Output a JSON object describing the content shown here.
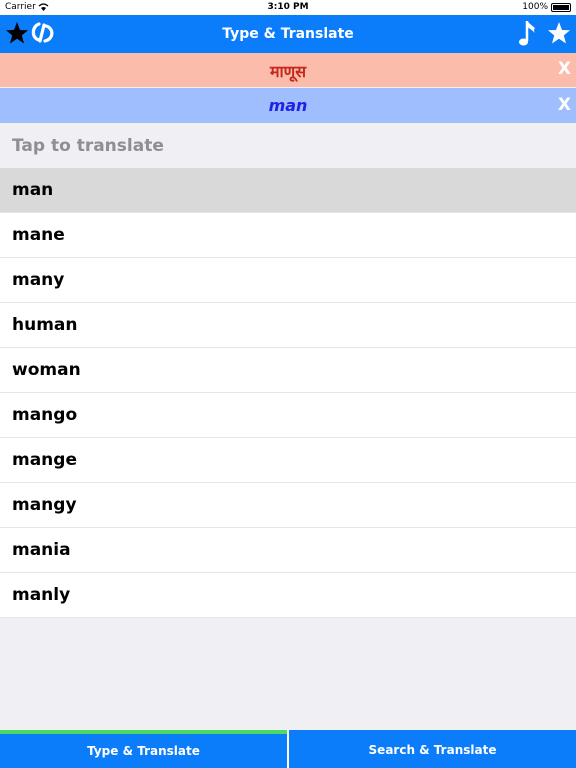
{
  "status": {
    "carrier": "Carrier",
    "time": "3:10 PM",
    "battery": "100%"
  },
  "nav": {
    "title": "Type & Translate"
  },
  "source": {
    "text": "माणूस",
    "clear": "X"
  },
  "target": {
    "text": "man",
    "clear": "X"
  },
  "hint": {
    "text": "Tap to translate"
  },
  "suggestions": [
    "man",
    "mane",
    "many",
    "human",
    "woman",
    "mango",
    "mange",
    "mangy",
    "mania",
    "manly"
  ],
  "tabs": {
    "type_translate": "Type & Translate",
    "search_translate": "Search & Translate"
  },
  "colors": {
    "nav": "#0b7dfb",
    "source_bg": "#fcbcab",
    "target_bg": "#9fbefe",
    "active_tab_indicator": "#4cd964"
  }
}
